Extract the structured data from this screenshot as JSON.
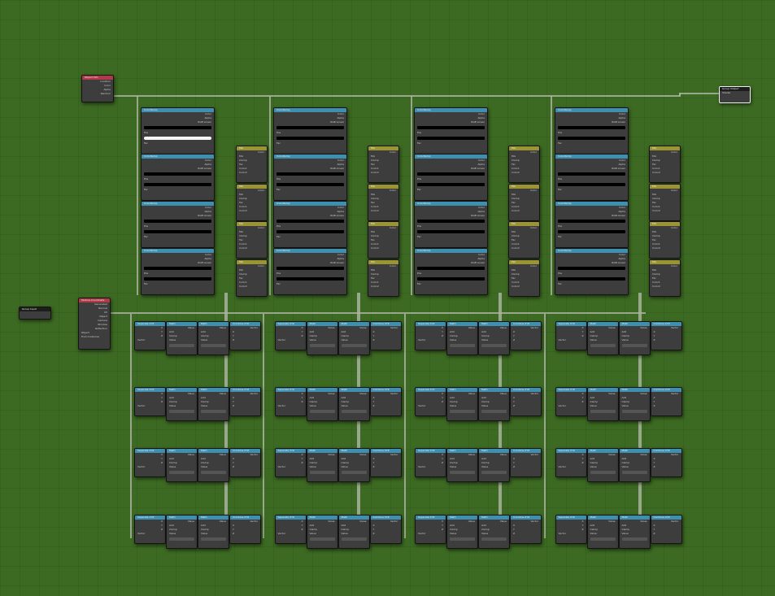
{
  "editor": "Shader Editor",
  "colors": {
    "background": "#3c6a22",
    "wire": "#a9b3a0",
    "input_header": "#b23a48",
    "color_header": "#3f8fb0",
    "converter_header": "#9a9433"
  },
  "object_info": {
    "title": "Object Info",
    "outputs": [
      "Location",
      "Color",
      "Alpha",
      "Random"
    ]
  },
  "group_input": {
    "title": "Group Input"
  },
  "group_output": {
    "title": "Group Output",
    "inputs": [
      "Shader"
    ]
  },
  "tex_coord": {
    "title": "Texture Coordinate",
    "outputs": [
      "Generated",
      "Normal",
      "UV",
      "Object",
      "Camera",
      "Window",
      "Reflection"
    ],
    "object_label": "Object",
    "instancer_label": "From Instancer"
  },
  "color_ramp": {
    "title": "ColorRamp",
    "outputs": [
      "Color",
      "Alpha"
    ],
    "mode": "RGB",
    "interp": "Linear",
    "pos_label": "Pos",
    "fac_label": "Fac"
  },
  "mix": {
    "title": "Mix",
    "output": "Color",
    "blend": "Mix",
    "clamp": "Clamp",
    "fac": "Fac",
    "color1": "Color1",
    "color2": "Color2"
  },
  "separate": {
    "title": "Separate XYZ",
    "outputs": [
      "X",
      "Y",
      "Z"
    ],
    "input": "Vector"
  },
  "math": {
    "title": "Math",
    "output": "Value",
    "op": "Add",
    "clamp": "Clamp",
    "value": "Value"
  },
  "combine": {
    "title": "Combine XYZ",
    "output": "Vector",
    "inputs": [
      "X",
      "Y",
      "Z"
    ]
  }
}
